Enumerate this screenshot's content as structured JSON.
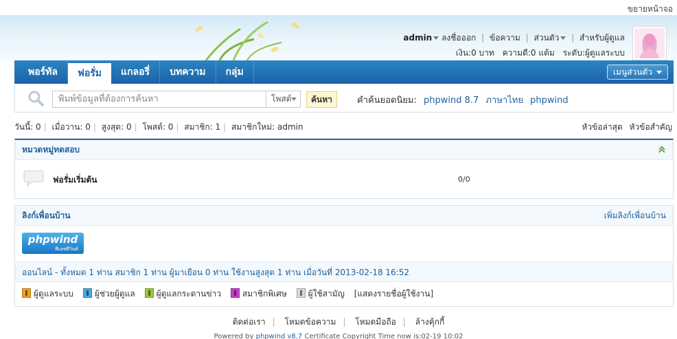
{
  "topbar": {
    "expand_label": "ขยายหน้าจอ"
  },
  "user": {
    "username": "admin",
    "logout": "ลงชื่อออก",
    "messages": "ข้อความ",
    "personal": "ส่วนตัว",
    "admin_panel": "สำหรับผู้ดูแล",
    "money": "เงิน:0 บาท",
    "reputation": "ความดี:0 แต้ม",
    "level": "ระดับ:ผู้ดูแลระบบ"
  },
  "nav": {
    "items": [
      {
        "label": "พอร์ทัล",
        "active": false
      },
      {
        "label": "ฟอรั่ม",
        "active": true
      },
      {
        "label": "แกลอรี่",
        "active": false
      },
      {
        "label": "บทความ",
        "active": false
      },
      {
        "label": "กลุ่ม",
        "active": false
      }
    ],
    "my_menu": "เมนูส่วนตัว"
  },
  "search": {
    "placeholder": "พิมพ์ข้อมูลที่ต้องการค้นหา",
    "type": "โพสต์",
    "button": "ค้นหา",
    "hot_label": "คำค้นยอดนิยม:",
    "hot_terms": [
      "phpwind 8.7",
      "ภาษาไทย",
      "phpwind"
    ]
  },
  "stats": {
    "today": "วันนี้: 0",
    "yesterday": "เมื่อวาน: 0",
    "highest": "สูงสุด: 0",
    "posts": "โพสต์: 0",
    "members": "สมาชิก: 1",
    "newest": "สมาชิกใหม่: admin",
    "latest_topics": "หัวข้อล่าสุด",
    "important_topics": "หัวข้อสำคัญ"
  },
  "category": {
    "title": "หมวดหมู่ทดสอบ",
    "forums": [
      {
        "name": "ฟอรั่มเริ่มต้น",
        "count": "0/0"
      }
    ]
  },
  "links": {
    "title": "ลิงก์เพื่อนบ้าน",
    "add": "เพิ่มลิงก์เพื่อนบ้าน",
    "logo_text": "phpwind",
    "logo_sub": "พีเอชพีวินด์"
  },
  "online": {
    "text": "ออนไลน์ - ทั้งหมด 1 ท่าน สมาชิก 1 ท่าน ผู้มาเยือน 0 ท่าน ใช้งานสูงสุด 1 ท่าน เมื่อวันที่ 2013-02-18 16:52"
  },
  "legend": {
    "items": [
      {
        "label": "ผู้ดูแลระบบ",
        "color": "#f0a020"
      },
      {
        "label": "ผู้ช่วยผู้ดูแล",
        "color": "#4aa8e0"
      },
      {
        "label": "ผู้ดูแลกระดานข่าว",
        "color": "#9bc83c"
      },
      {
        "label": "สมาชิกพิเศษ",
        "color": "#c83cc8"
      },
      {
        "label": "ผู้ใช้สามัญ",
        "color": "#d8d8d8"
      }
    ],
    "show_users": "[แสดงรายชื่อผู้ใช้งาน]"
  },
  "footer": {
    "links": [
      "ติดต่อเรา",
      "โหมดข้อความ",
      "โหมดมือถือ",
      "ล้างคุ้กกี้"
    ],
    "powered_prefix": "Powered by",
    "powered_link": "phpwind v8.7",
    "powered_suffix": "Certificate Copyright Time now is:02-19 10:02"
  }
}
